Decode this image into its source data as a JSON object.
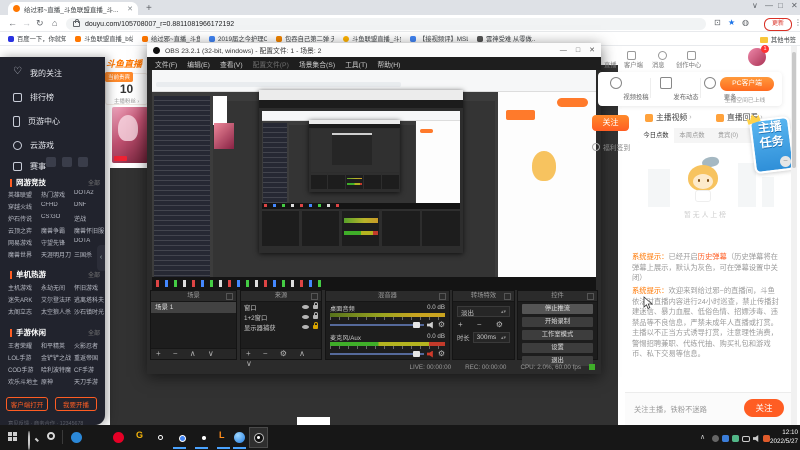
{
  "colors": {
    "accent": "#ff5d23",
    "douyu_orange": "#ff7700",
    "live_green": "#3fae29",
    "update_red": "#d93025",
    "task_blue": "#58b5f0"
  },
  "browser": {
    "tab_title": "给过邪~直播_斗鱼联盟直播_斗...",
    "url": "douyu.com/105708007_r=0.8811081966172192",
    "update_label": "更新",
    "icons": {
      "back": "←",
      "forward": "→",
      "reload": "↻",
      "home": "⌂",
      "min": "—",
      "max": "□",
      "close": "✕",
      "vee": "∨",
      "newtab": "+",
      "menu": "⋮"
    },
    "bookmarks": [
      "百度一下，你就知道",
      "斗鱼联盟直播_b站直...",
      "给过邪~直播_斗鱼...",
      "2019届之今护理C...",
      "包吞自己第二弹 无...",
      "斗鱼联盟直播_斗鱼...",
      "【接视频评】MSL...",
      "雲神受难 从零做..."
    ],
    "other_bookmarks": "其他书签"
  },
  "sidebar": {
    "nav": [
      {
        "label": "我的关注"
      },
      {
        "label": "排行榜"
      },
      {
        "label": "页游中心"
      },
      {
        "label": "云游戏"
      },
      {
        "label": "赛事"
      }
    ],
    "sections": [
      {
        "title": "网游竞技",
        "more": "全部",
        "items": [
          "英雄联盟",
          "热门游戏",
          "DOTA2",
          "穿越火线",
          "CFHD",
          "DNF",
          "炉石传说",
          "CS:GO",
          "逆战",
          "云顶之弈",
          "魔兽争霸",
          "魔兽怀旧服",
          "网易游戏",
          "守望先锋",
          "DOTA",
          "魔兽世界",
          "天涯明月刀",
          "三国杀"
        ]
      },
      {
        "title": "单机热游",
        "more": "全部",
        "items": [
          "主机游戏",
          "永劫无间",
          "怀旧游戏",
          "迷失ARK",
          "艾尔登法环",
          "逃离塔科夫",
          "太阁立志",
          "太空狼人杀",
          "沙石镇时光"
        ]
      },
      {
        "title": "手游休闲",
        "more": "全部",
        "items": [
          "王者荣耀",
          "和平精英",
          "火影忍者",
          "LOL手游",
          "金铲铲之战",
          "重返帝国",
          "COD手游",
          "哈利波特魔",
          "CF手游",
          "欢乐斗地主",
          "原神",
          "天刀手游"
        ]
      }
    ],
    "open_client": "客户端打开",
    "start_stream": "我要开播",
    "footer": "意见反馈 · 商务合作 · 12345678",
    "collapse": "‹"
  },
  "page": {
    "logo": "斗鱼直播",
    "vip_badge": "当前贵宾",
    "vip_count": "10",
    "vip_link": "主播粉丝 ›"
  },
  "obs": {
    "title": "OBS 23.2.1 (32-bit, windows) - 配置文件: 1 - 场景: 2",
    "window": {
      "min": "—",
      "max": "□",
      "close": "✕"
    },
    "menu": [
      "文件(F)",
      "编辑(E)",
      "查看(V)",
      "配置文件(P)",
      "场景集合(S)",
      "工具(T)",
      "帮助(H)"
    ],
    "scenes": {
      "header": "场景",
      "items": [
        "场景 1"
      ],
      "toolbar": "+ − ∧ ∨"
    },
    "sources": {
      "header": "来源",
      "items": [
        "窗口",
        "1+2窗口",
        "显示器捕获"
      ],
      "toolbar": "+ − ⚙ ∧ ∨"
    },
    "mixer": {
      "header": "混音器",
      "channels": [
        {
          "name": "桌面音频",
          "db": "0.0 dB"
        },
        {
          "name": "麦克风/Aux",
          "db": "0.0 dB"
        }
      ]
    },
    "transitions": {
      "header": "转场特效",
      "value": "淡出",
      "icons": "+ − ⚙",
      "duration_label": "时长",
      "duration": "300ms"
    },
    "controls": {
      "header": "控件",
      "buttons": [
        "停止推流",
        "开始录制",
        "工作室模式",
        "设置",
        "退出"
      ]
    },
    "status": {
      "live": "LIVE: 00:00:00",
      "rec": "REC: 00:00:00",
      "cpu": "CPU: 2.0%, 60.00 fps"
    }
  },
  "right_panel": {
    "nav": [
      "直播",
      "客户端",
      "消息",
      "创作中心"
    ],
    "badge": "1",
    "actions": [
      "视频投稿",
      "发布动态",
      "更多"
    ],
    "pc_button": "PC客户端",
    "pc_sub": "主播空间已上线",
    "follow": "关注",
    "welfare": "福利签到",
    "tabs": [
      "主播视频",
      "直播回看"
    ],
    "subtabs": [
      "今日点数",
      "本周点数",
      "贵宾(0)",
      "钻粉"
    ],
    "empty": "暂无人上榜",
    "task_badge": [
      "主播",
      "任务"
    ],
    "messages": [
      {
        "prefix": "系统提示：",
        "t1": "已经开启",
        "hl": "历史弹幕",
        "t2": "（历史弹幕将在弹幕上展示，默认为灰色，可在弹幕设置中关闭）"
      },
      {
        "prefix": "系统提示：",
        "t1": "欢迎来到给过邪~的直播间，斗鱼依法对直播内容进行24小时巡查，禁止传播封建迷信、暴力血腥、低俗色情、招嫖涉毒、违禁品等不良信息，严禁未成年人直播或打赏。主播以不正当方式诱导打赏，注意理性消费，警惕招聘兼职、代练代抽、购买礼包和游戏币、私下交易等信息。"
      }
    ],
    "footer_text": "关注主播，铁粉不迷路",
    "footer_button": "关注"
  },
  "taskbar": {
    "time": "12:10",
    "date": "2022/5/27"
  }
}
